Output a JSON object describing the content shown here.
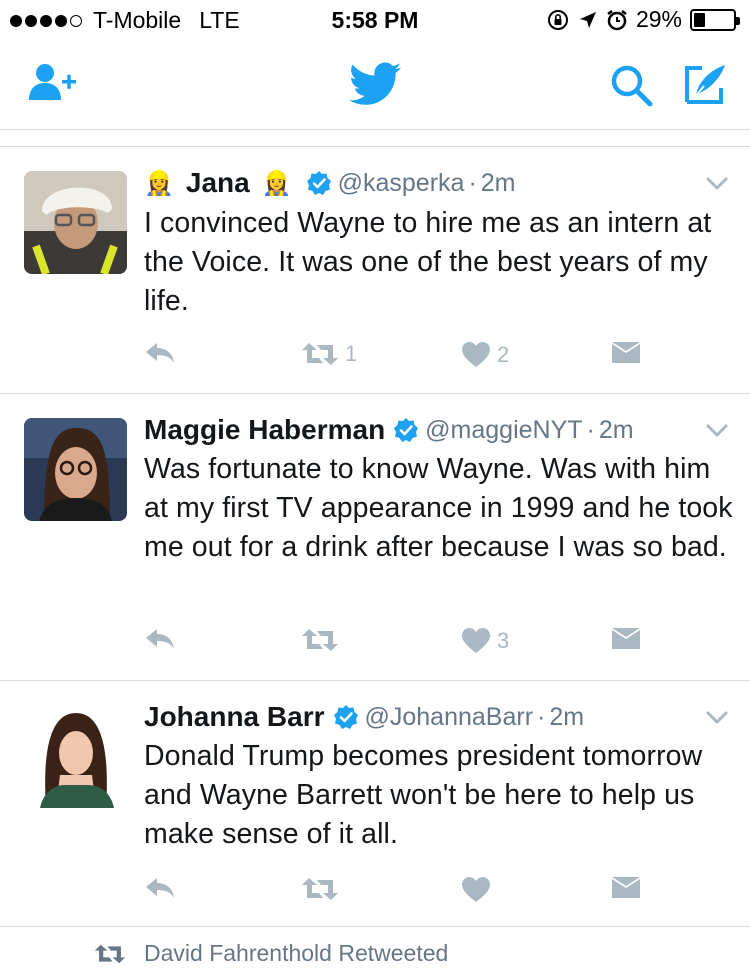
{
  "status_bar": {
    "carrier": "T-Mobile",
    "network": "LTE",
    "time": "5:58 PM",
    "battery": "29%",
    "battery_level": 0.29
  },
  "nav": {
    "icons": [
      "add-user-icon",
      "twitter-bird-icon",
      "search-icon",
      "compose-icon"
    ],
    "accent_color": "#1da1f2"
  },
  "tweets": [
    {
      "name": "Jana",
      "name_emoji": "👷‍♀️",
      "handle": "@kasperka",
      "dot": "·",
      "time": "2m",
      "text": "I convinced Wayne to hire me as an intern at the Voice. It was one of the best years of my life.",
      "retweets": "1",
      "likes": "2"
    },
    {
      "name": "Maggie Haberman",
      "handle": "@maggieNYT",
      "dot": "·",
      "time": "2m",
      "text": "Was fortunate to know Wayne. Was with him at my first TV appearance in 1999 and he took me out for a drink after because I was so bad.",
      "retweets": "",
      "likes": "3"
    },
    {
      "name": "Johanna Barr",
      "handle": "@JohannaBarr",
      "dot": "·",
      "time": "2m",
      "text": "Donald Trump becomes president tomorrow and Wayne Barrett won't be here to help us make sense of it all.",
      "retweets": "",
      "likes": ""
    }
  ],
  "retweeted_by": "David Fahrenthold Retweeted"
}
